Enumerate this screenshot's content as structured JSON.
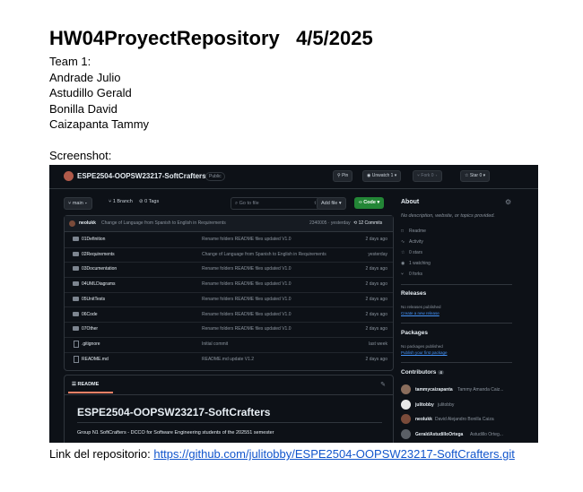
{
  "document": {
    "title": "HW04ProyectRepository   4/5/2025",
    "team_lines": [
      "Team 1:",
      "Andrade Julio",
      "Astudillo Gerald",
      "Bonilla David",
      "Caizapanta Tammy"
    ],
    "screenshot_label": "Screenshot:",
    "link_prefix": "Link del repositorio: ",
    "link_text": "https://github.com/julitobby/ESPE2504-OOPSW23217-SoftCrafters.git"
  },
  "github": {
    "repo_name": "ESPE2504-OOPSW23217-SoftCrafters",
    "visibility": "Public",
    "header_buttons": {
      "pin": "Pin",
      "unwatch": "Unwatch",
      "unwatch_count": "1",
      "fork": "Fork",
      "fork_count": "0",
      "star": "Star",
      "star_count": "0"
    },
    "branch": "main",
    "branches": "1 Branch",
    "tags": "0 Tags",
    "search_placeholder": "Go to file",
    "search_key": "t",
    "add_file": "Add file",
    "code": "Code",
    "last_commit": {
      "user": "neolukk",
      "message": "Change of Language from Spanish to English in Requirements",
      "meta": "2340005 · yesterday",
      "commits": "12 Commits"
    },
    "files": [
      {
        "name": "01Definition",
        "message": "Rename folders README files updated V1.0",
        "date": "2 days ago",
        "type": "folder"
      },
      {
        "name": "02Requirements",
        "message": "Change of Language from Spanish to English in Requirements",
        "date": "yesterday",
        "type": "folder"
      },
      {
        "name": "03Documentation",
        "message": "Rename folders README files updated V1.0",
        "date": "2 days ago",
        "type": "folder"
      },
      {
        "name": "04UMLDiagrams",
        "message": "Rename folders README files updated V1.0",
        "date": "2 days ago",
        "type": "folder"
      },
      {
        "name": "05UnitTests",
        "message": "Rename folders README files updated V1.0",
        "date": "2 days ago",
        "type": "folder"
      },
      {
        "name": "06Code",
        "message": "Rename folders README files updated V1.0",
        "date": "2 days ago",
        "type": "folder"
      },
      {
        "name": "07Other",
        "message": "Rename folders README files updated V1.0",
        "date": "2 days ago",
        "type": "folder"
      },
      {
        "name": ".gitignore",
        "message": "Initial commit",
        "date": "last week",
        "type": "file"
      },
      {
        "name": "README.md",
        "message": "README.md update V1.2",
        "date": "2 days ago",
        "type": "file"
      }
    ],
    "readme": {
      "tab": "README",
      "heading": "ESPE2504-OOPSW23217-SoftCrafters",
      "paragraph": "Group N1 SoftCrafters - DCCO for Software Engineering students of the 202551 semester"
    },
    "about": {
      "heading": "About",
      "description": "No description, website, or topics provided.",
      "items": [
        "Readme",
        "Activity",
        "0 stars",
        "1 watching",
        "0 forks"
      ]
    },
    "releases": {
      "heading": "Releases",
      "note": "No releases published",
      "link": "Create a new release"
    },
    "packages": {
      "heading": "Packages",
      "note": "No packages published",
      "link": "Publish your first package"
    },
    "contributors": {
      "heading": "Contributors",
      "count": "4",
      "list": [
        {
          "user": "tammycaizapanta",
          "name": "Tammy Amanda Caiz..."
        },
        {
          "user": "julitobby",
          "name": "julitobby"
        },
        {
          "user": "neolukk",
          "name": "David Alejandro Bonilla Caiza"
        },
        {
          "user": "GeraldAstudilloOrtega",
          "name": "Astudillo Orteg..."
        }
      ]
    }
  }
}
